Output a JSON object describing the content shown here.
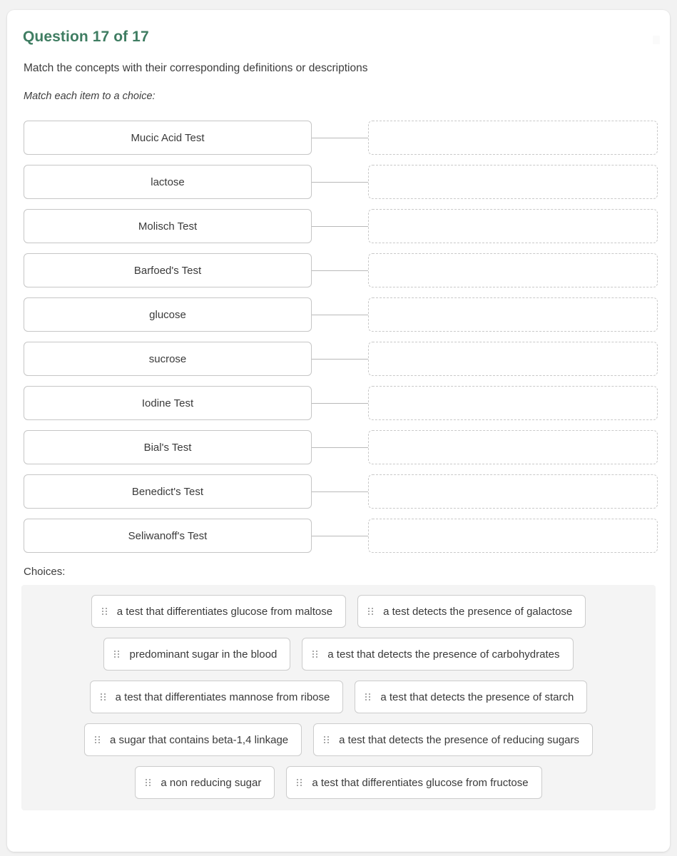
{
  "question": {
    "title": "Question 17 of 17",
    "prompt": "Match the concepts with their corresponding definitions or descriptions",
    "subprompt": "Match each item to a choice:"
  },
  "items": [
    {
      "label": "Mucic Acid Test"
    },
    {
      "label": "lactose"
    },
    {
      "label": "Molisch Test"
    },
    {
      "label": "Barfoed's Test"
    },
    {
      "label": "glucose"
    },
    {
      "label": "sucrose"
    },
    {
      "label": "Iodine Test"
    },
    {
      "label": "Bial's Test"
    },
    {
      "label": "Benedict's Test"
    },
    {
      "label": "Seliwanoff's Test"
    }
  ],
  "drop_zones": [
    {
      "value": ""
    },
    {
      "value": ""
    },
    {
      "value": ""
    },
    {
      "value": ""
    },
    {
      "value": ""
    },
    {
      "value": ""
    },
    {
      "value": ""
    },
    {
      "value": ""
    },
    {
      "value": ""
    },
    {
      "value": ""
    }
  ],
  "choices": {
    "label": "Choices:",
    "rows": [
      [
        {
          "label": "a test that differentiates glucose from maltose"
        },
        {
          "label": "a test detects the presence of galactose"
        }
      ],
      [
        {
          "label": "predominant sugar in the blood"
        },
        {
          "label": "a test that detects the presence of carbohydrates"
        }
      ],
      [
        {
          "label": "a test that differentiates mannose from ribose"
        },
        {
          "label": "a test that detects the presence of starch"
        }
      ],
      [
        {
          "label": "a sugar that contains beta-1,4 linkage"
        },
        {
          "label": "a test that detects the presence of reducing sugars"
        }
      ],
      [
        {
          "label": "a non reducing sugar"
        },
        {
          "label": "a test that differentiates glucose from fructose"
        }
      ]
    ]
  },
  "colors": {
    "title_green": "#3f7d62",
    "page_background": "#f2f2f2",
    "card_background": "#ffffff",
    "choices_panel_background": "#f4f4f4",
    "box_border": "#c6c6c6",
    "dropzone_border": "#c9c9c9"
  }
}
